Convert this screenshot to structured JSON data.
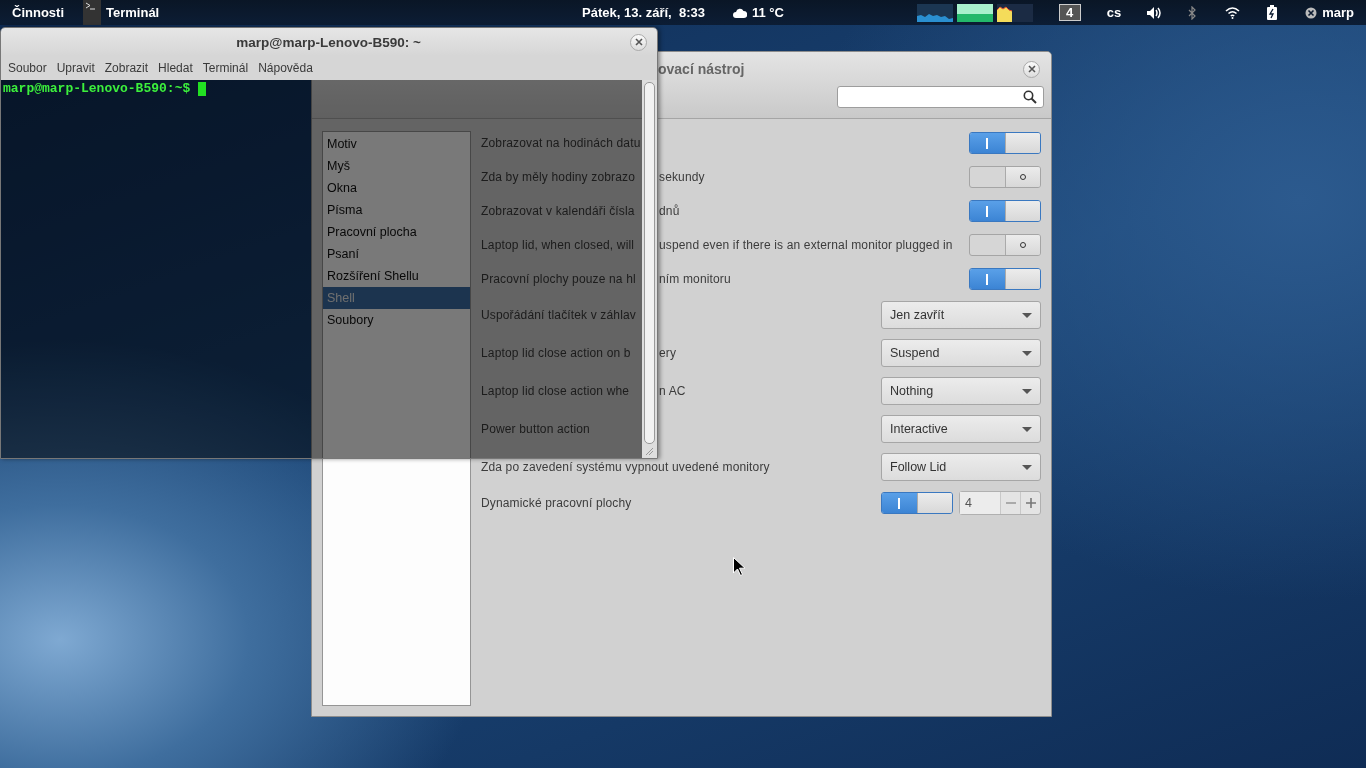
{
  "top_bar": {
    "activities": "Činnosti",
    "app_name": "Terminál",
    "clock": "Pátek, 13. září,  8:33",
    "weather": "11 °C",
    "workspace": "4",
    "keyboard": "cs",
    "user": "marp"
  },
  "tweak_window": {
    "title": "ovací nástroj",
    "sidebar": [
      {
        "label": "Motiv",
        "selected": false
      },
      {
        "label": "Myš",
        "selected": false
      },
      {
        "label": "Okna",
        "selected": false
      },
      {
        "label": "Písma",
        "selected": false
      },
      {
        "label": "Pracovní plocha",
        "selected": false
      },
      {
        "label": "Psaní",
        "selected": false
      },
      {
        "label": "Rozšíření Shellu",
        "selected": false
      },
      {
        "label": "Shell",
        "selected": true
      },
      {
        "label": "Soubory",
        "selected": false
      }
    ],
    "settings": [
      {
        "kind": "switch",
        "label": "Zobrazovat na hodinách datu",
        "on": true
      },
      {
        "kind": "switch",
        "label": "Zda by měly hodiny zobrazo",
        "label_rest": "sekundy",
        "on": false
      },
      {
        "kind": "switch",
        "label": "Zobrazovat v kalendáři čísla",
        "label_rest": "dnů",
        "on": true
      },
      {
        "kind": "switch",
        "label": "Laptop lid, when closed, will",
        "label_rest": "uspend even if there is an external monitor plugged in",
        "on": false
      },
      {
        "kind": "switch",
        "label": "Pracovní plochy pouze na hl",
        "label_rest": "ním monitoru",
        "on": true
      },
      {
        "kind": "dropdown",
        "label": "Uspořádání tlačítek v záhlav",
        "value": "Jen zavřít"
      },
      {
        "kind": "dropdown",
        "label": "Laptop lid close action on b",
        "label_rest": "ery",
        "value": "Suspend"
      },
      {
        "kind": "dropdown",
        "label": "Laptop lid close action whe",
        "label_rest": "n AC",
        "value": "Nothing"
      },
      {
        "kind": "dropdown",
        "label": "Power button action",
        "value": "Interactive"
      },
      {
        "kind": "dropdown",
        "label": "Zda po zavedení systému vypnout uvedené monitory",
        "value": "Follow Lid"
      },
      {
        "kind": "switch_spin",
        "label": "Dynamické pracovní plochy",
        "on": true,
        "value": "4"
      }
    ]
  },
  "terminal": {
    "title": "marp@marp-Lenovo-B590: ~",
    "menu": [
      "Soubor",
      "Upravit",
      "Zobrazit",
      "Hledat",
      "Terminál",
      "Nápověda"
    ],
    "prompt": "marp@marp-Lenovo-B590:~$"
  }
}
